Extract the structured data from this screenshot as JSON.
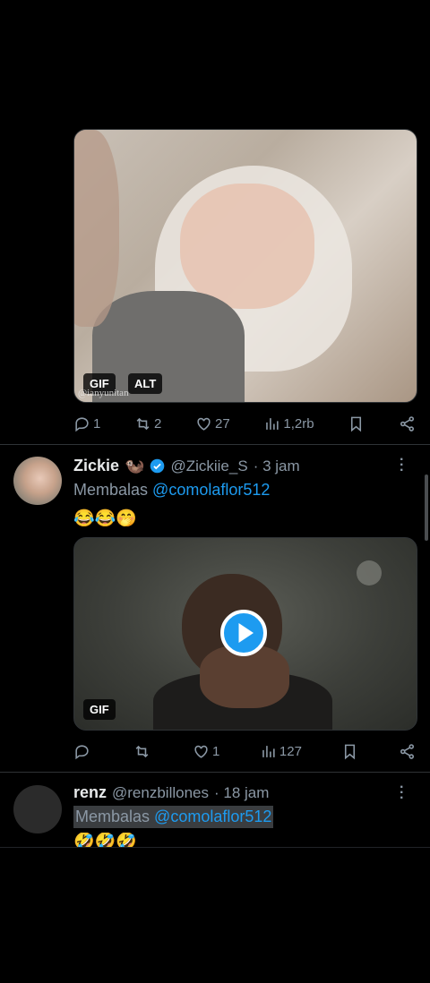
{
  "tweet1": {
    "media_badges": {
      "gif": "GIF",
      "alt": "ALT"
    },
    "watermark": "@ianyunitan",
    "actions": {
      "replies": "1",
      "retweets": "2",
      "likes": "27",
      "views": "1,2rb"
    }
  },
  "tweet2": {
    "name": "Zickie",
    "name_emoji": "🦦",
    "handle": "@Zickiie_S",
    "time": "· 3 jam",
    "reply_prefix": "Membalas",
    "reply_to": "@comolaflor512",
    "body": "😂😂🤭",
    "media_badge": "GIF",
    "actions": {
      "replies": "",
      "retweets": "",
      "likes": "1",
      "views": "127"
    }
  },
  "tweet3": {
    "name": "renz",
    "handle": "@renzbillones",
    "time": "· 18 jam",
    "reply_prefix": "Membalas",
    "reply_to": "@comolaflor512",
    "body": "🤣🤣🤣"
  },
  "colors": {
    "background": "#000000",
    "accent": "#1d9bf0",
    "muted": "#8b98a5",
    "verified": "#1d9bf0"
  }
}
